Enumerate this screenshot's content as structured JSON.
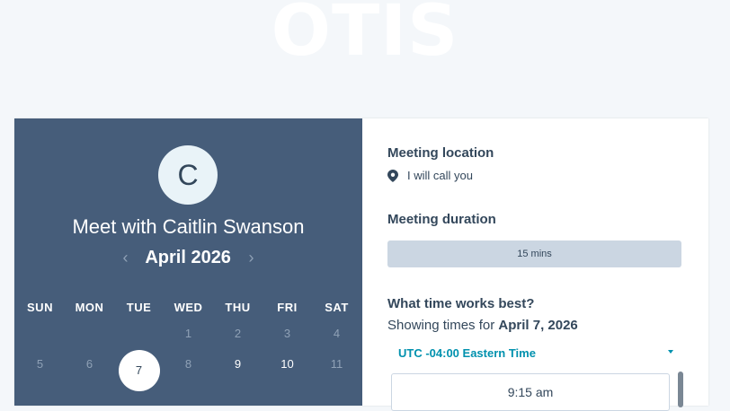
{
  "logo": {
    "text": "OTIS"
  },
  "host": {
    "avatar_initial": "C",
    "title": "Meet with Caitlin Swanson"
  },
  "calendar": {
    "prev_icon": "chevron-left-icon",
    "next_icon": "chevron-right-icon",
    "prev_glyph": "‹",
    "next_glyph": "›",
    "month_label": "April 2026",
    "weekdays": [
      "SUN",
      "MON",
      "TUE",
      "WED",
      "THU",
      "FRI",
      "SAT"
    ],
    "weeks": [
      [
        {
          "day": "",
          "state": "empty"
        },
        {
          "day": "",
          "state": "empty"
        },
        {
          "day": "",
          "state": "empty"
        },
        {
          "day": "1",
          "state": "unavailable"
        },
        {
          "day": "2",
          "state": "unavailable"
        },
        {
          "day": "3",
          "state": "unavailable"
        },
        {
          "day": "4",
          "state": "unavailable"
        }
      ],
      [
        {
          "day": "5",
          "state": "unavailable"
        },
        {
          "day": "6",
          "state": "unavailable"
        },
        {
          "day": "7",
          "state": "selected"
        },
        {
          "day": "8",
          "state": "unavailable"
        },
        {
          "day": "9",
          "state": "available"
        },
        {
          "day": "10",
          "state": "available"
        },
        {
          "day": "11",
          "state": "unavailable"
        }
      ]
    ]
  },
  "details": {
    "location_label": "Meeting location",
    "location_icon": "map-pin-icon",
    "location_value": "I will call you",
    "duration_label": "Meeting duration",
    "duration_value": "15 mins",
    "time_question": "What time works best?",
    "showing_prefix": "Showing times for ",
    "showing_date": "April 7, 2026",
    "timezone": "UTC -04:00 Eastern Time",
    "first_slot": "9:15 am"
  },
  "colors": {
    "panel": "#465d7a",
    "accent": "#0091ae",
    "text": "#33475b",
    "duration_bg": "#cbd6e2"
  }
}
